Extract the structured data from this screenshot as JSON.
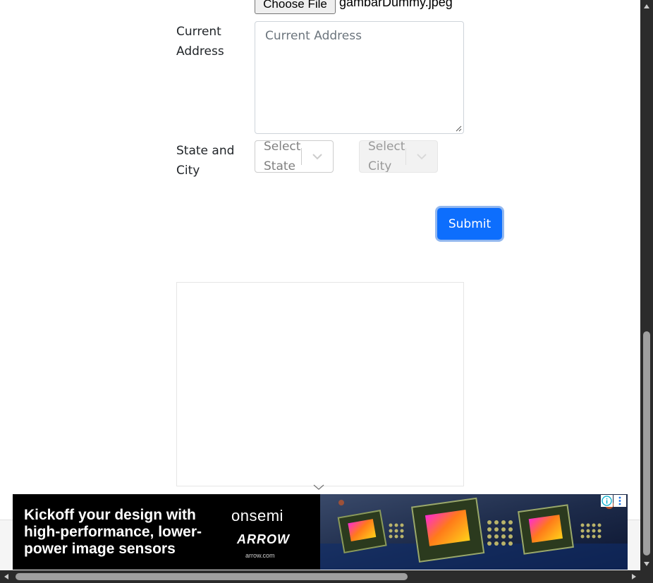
{
  "form": {
    "file": {
      "button_label": "Choose File",
      "file_name": "gambarDummy.jpeg"
    },
    "current_address": {
      "label": "Current Address",
      "placeholder": "Current Address"
    },
    "state_city": {
      "label": "State and City",
      "state_placeholder": "Select State",
      "city_placeholder": "Select City"
    },
    "submit_label": "Submit"
  },
  "banner_ad": {
    "headline": "Kickoff your design with high-performance, lower-power image sensors",
    "brand_primary": "onsemi",
    "brand_secondary": "ARROW",
    "url": "arrow.com",
    "info_icon": "info-icon",
    "menu_icon": "kebab-menu-icon"
  },
  "colors": {
    "submit_bg": "#0d6efd",
    "submit_focus_ring": "#93b8ef",
    "banner_bg": "#000000",
    "scrollbar_track": "#2b2b2b",
    "scrollbar_thumb": "#9f9f9f"
  }
}
